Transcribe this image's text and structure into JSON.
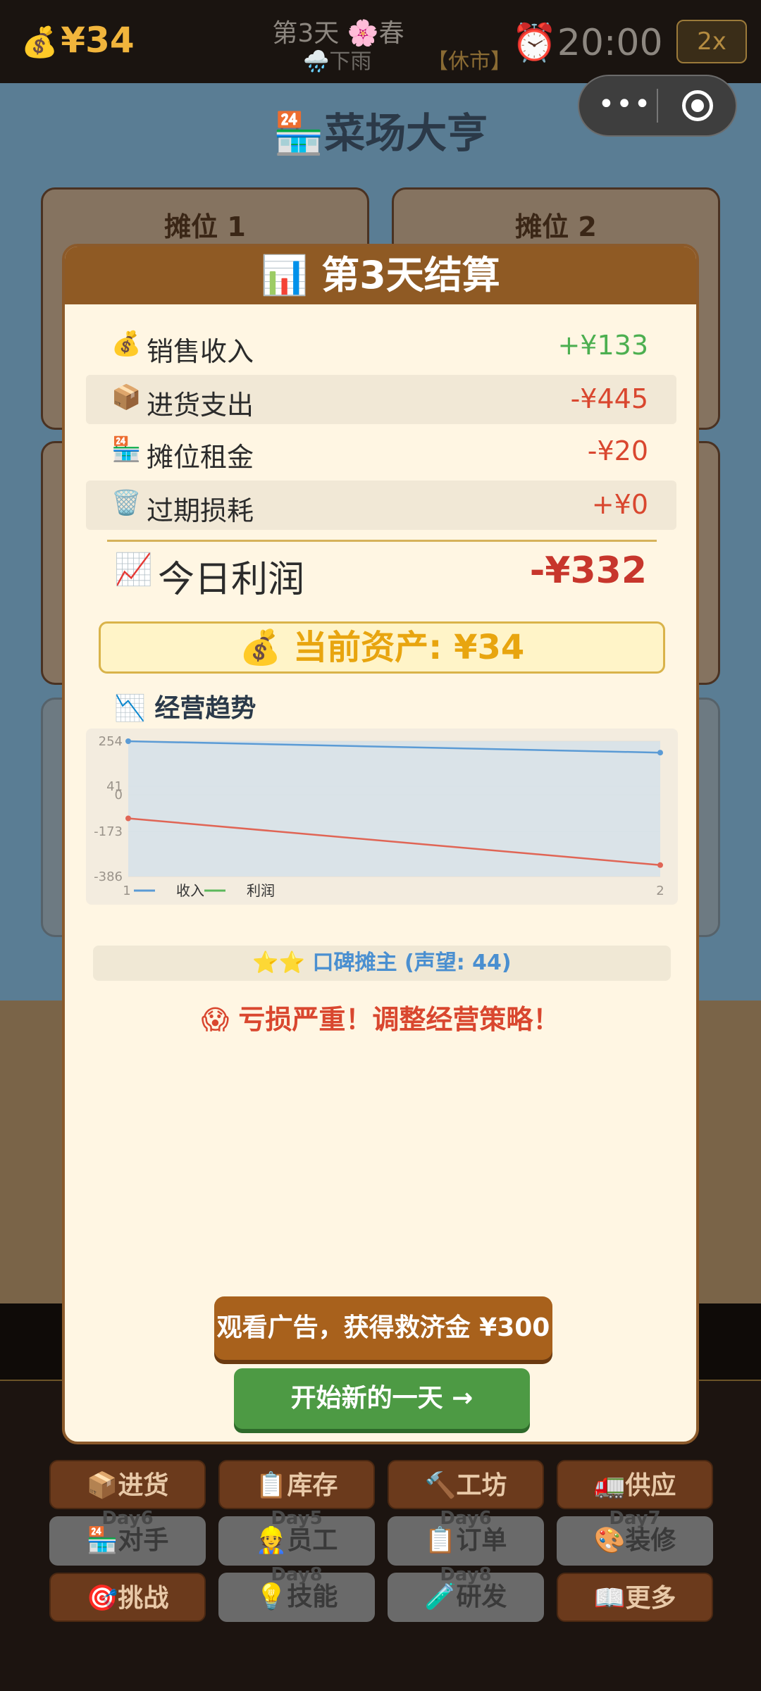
{
  "topbar": {
    "money_icon": "money-bag-icon",
    "money": "¥34",
    "day_season": "第3天 🌸春",
    "weather": "🌧️下雨",
    "market_status": "【休市】",
    "clock": "⏰20:00",
    "speed": "2x",
    "capsule_more": "•••"
  },
  "game_title": "🏪菜场大亨",
  "stalls": [
    "摊位 1",
    "摊位 2"
  ],
  "modal": {
    "title": "📊 第3天结算",
    "rows": [
      {
        "icon": "💰",
        "label": "销售收入",
        "value": "+¥133"
      },
      {
        "icon": "📦",
        "label": "进货支出",
        "value": "-¥445"
      },
      {
        "icon": "🏪",
        "label": "摊位租金",
        "value": "-¥20"
      },
      {
        "icon": "🗑️",
        "label": "过期损耗",
        "value": "+¥0"
      }
    ],
    "profit": {
      "icon": "📈",
      "label": "今日利润",
      "value": "-¥332"
    },
    "assets": "💰 当前资产: ¥34",
    "trend_title": "📉 经营趋势",
    "reputation": "⭐⭐ 口碑摊主 (声望: 44)",
    "warning": "😱 亏损严重！调整经营策略！",
    "ad_button": "观看广告，获得救济金 ¥300",
    "next_button": "开始新的一天 →"
  },
  "chart_data": {
    "type": "line",
    "x": [
      1,
      2
    ],
    "series": [
      {
        "name": "收入",
        "values": [
          254,
          200
        ]
      },
      {
        "name": "利润",
        "values": [
          -111,
          -332
        ]
      }
    ],
    "y_tick_labels": [
      "254",
      "41",
      "0",
      "-173",
      "-386"
    ],
    "x_tick_labels": [
      "1",
      "2"
    ],
    "ylim": [
      -386,
      254
    ],
    "grid": true,
    "legend": "bottom-left",
    "colors": {
      "income": "#5b9bd5",
      "profit": "#e06555",
      "legend_profit": "#5cb85c",
      "area": "#d5e2ea"
    }
  },
  "menu": [
    {
      "label": "📦进货",
      "day": "",
      "enabled": true
    },
    {
      "label": "📋库存",
      "day": "",
      "enabled": true
    },
    {
      "label": "🔨工坊",
      "day": "",
      "enabled": true
    },
    {
      "label": "🚛供应",
      "day": "",
      "enabled": true
    },
    {
      "label": "🏪对手",
      "day": "Day6",
      "enabled": false
    },
    {
      "label": "👷员工",
      "day": "Day5",
      "enabled": false
    },
    {
      "label": "📋订单",
      "day": "Day6",
      "enabled": false
    },
    {
      "label": "🎨装修",
      "day": "Day7",
      "enabled": false
    },
    {
      "label": "🎯挑战",
      "day": "",
      "enabled": true
    },
    {
      "label": "💡技能",
      "day": "Day8",
      "enabled": false
    },
    {
      "label": "🧪研发",
      "day": "Day8",
      "enabled": false
    },
    {
      "label": "📖更多",
      "day": "",
      "enabled": true
    }
  ]
}
